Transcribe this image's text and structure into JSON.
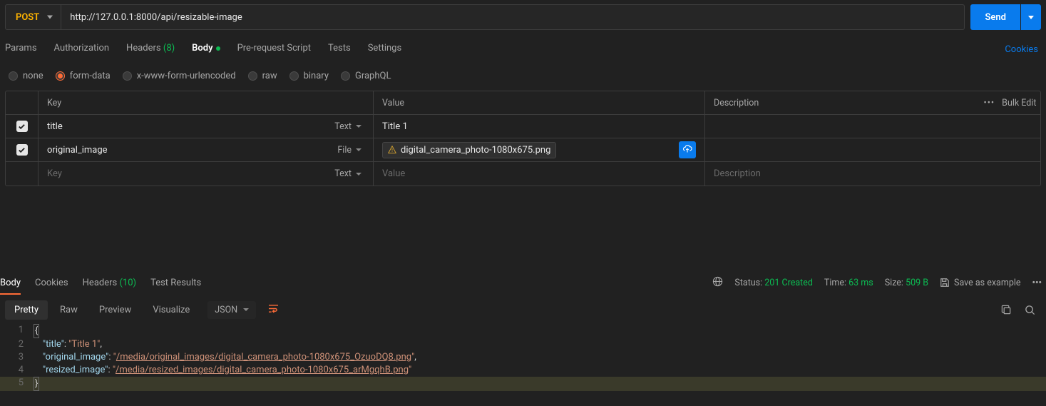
{
  "request": {
    "method": "POST",
    "url": "http://127.0.0.1:8000/api/resizable-image",
    "send": "Send"
  },
  "tabs": {
    "params": "Params",
    "auth": "Authorization",
    "headers_label": "Headers",
    "headers_count": "(8)",
    "body": "Body",
    "prereq": "Pre-request Script",
    "tests": "Tests",
    "settings": "Settings",
    "cookies": "Cookies"
  },
  "body_types": {
    "none": "none",
    "form": "form-data",
    "xwww": "x-www-form-urlencoded",
    "raw": "raw",
    "binary": "binary",
    "graphql": "GraphQL"
  },
  "table": {
    "headers": {
      "key": "Key",
      "value": "Value",
      "desc": "Description",
      "bulk": "Bulk Edit"
    },
    "rows": [
      {
        "enabled": true,
        "key": "title",
        "type": "Text",
        "value": "Title 1"
      },
      {
        "enabled": true,
        "key": "original_image",
        "type": "File",
        "file": "digital_camera_photo-1080x675.png"
      }
    ],
    "placeholder": {
      "key": "Key",
      "type": "Text",
      "value": "Value",
      "desc": "Description"
    }
  },
  "response": {
    "tabs": {
      "body": "Body",
      "cookies": "Cookies",
      "headers_label": "Headers",
      "headers_count": "(10)",
      "tests": "Test Results"
    },
    "status_label": "Status:",
    "status_value": "201 Created",
    "time_label": "Time:",
    "time_value": "63 ms",
    "size_label": "Size:",
    "size_value": "509 B",
    "save": "Save as example",
    "views": {
      "pretty": "Pretty",
      "raw": "Raw",
      "preview": "Preview",
      "visualize": "Visualize",
      "format": "JSON"
    },
    "json": {
      "k1": "\"title\"",
      "v1": "\"Title 1\"",
      "k2": "\"original_image\"",
      "v2q": "\"",
      "v2link": "/media/original_images/digital_camera_photo-1080x675_OzuoDQ8.png",
      "k3": "\"resized_image\"",
      "v3q": "\"",
      "v3link": "/media/resized_images/digital_camera_photo-1080x675_arMgqhB.png"
    }
  }
}
